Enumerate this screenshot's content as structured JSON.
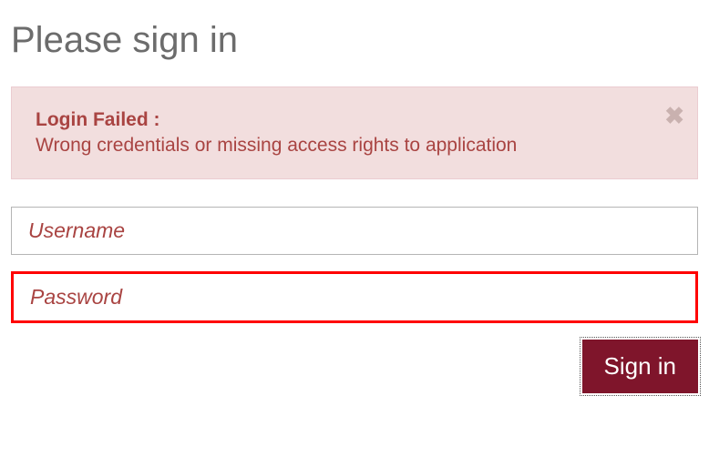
{
  "page": {
    "title": "Please sign in"
  },
  "alert": {
    "title": "Login Failed :",
    "message": "Wrong credentials or missing access rights to application"
  },
  "form": {
    "username_placeholder": "Username",
    "password_placeholder": "Password",
    "signin_label": "Sign in"
  }
}
